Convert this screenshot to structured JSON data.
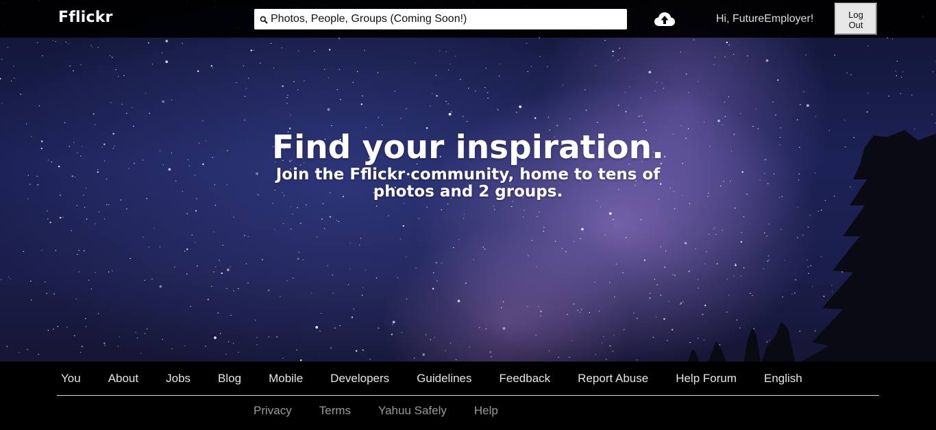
{
  "header": {
    "logo": "Fflickr",
    "search_placeholder": "Photos, People, Groups (Coming Soon!)",
    "greeting": "Hi, FutureEmployer!",
    "logout_label": "Log Out"
  },
  "hero": {
    "title": "Find your inspiration.",
    "subtitle": "Join the Fflickr community, home to tens of photos and 2 groups."
  },
  "footer": {
    "nav": [
      "You",
      "About",
      "Jobs",
      "Blog",
      "Mobile",
      "Developers",
      "Guidelines",
      "Feedback",
      "Report Abuse",
      "Help Forum",
      "English"
    ],
    "legal": [
      "Privacy",
      "Terms",
      "Yahuu Safely",
      "Help"
    ]
  },
  "icons": {
    "search": "search-icon",
    "upload": "cloud-upload-icon"
  },
  "colors": {
    "header_bg": "#000000",
    "footer_bg": "#000000",
    "footer_link": "#e6e6e6",
    "legal_link": "#9a9a9a",
    "hero_text": "#ffffff"
  }
}
